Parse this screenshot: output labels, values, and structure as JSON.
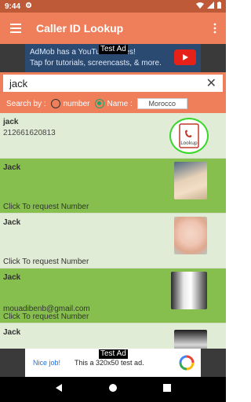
{
  "status": {
    "time": "9:44"
  },
  "appbar": {
    "title": "Caller ID Lookup"
  },
  "top_ad": {
    "tag": "Test Ad",
    "line1": "AdMob has a YouTube Series!",
    "line2": "Tap for tutorials, screencasts, & more."
  },
  "search": {
    "query": "jack"
  },
  "filter": {
    "label": "Search by :",
    "number_label": "number",
    "name_label": "Name :",
    "country": "Morocco"
  },
  "results": [
    {
      "name": "jack",
      "detail": "212661620813",
      "email": "",
      "action": ""
    },
    {
      "name": "Jack",
      "detail": "",
      "email": "",
      "action": "Click To request Number"
    },
    {
      "name": "Jack",
      "detail": "",
      "email": "",
      "action": "Click To request Number"
    },
    {
      "name": "Jack",
      "detail": "",
      "email": "mouadibenb@gmail.com",
      "action": "Click To request Number"
    },
    {
      "name": "Jack",
      "detail": "",
      "email": "",
      "action": ""
    }
  ],
  "bottom_ad": {
    "tag": "Test Ad",
    "nice": "Nice job!",
    "text": "This a 320x50 test ad."
  },
  "colors": {
    "primary": "#ef7f5a",
    "status": "#bf5a38",
    "row_dark": "#86bf4e",
    "row_light": "#e0ecd6"
  }
}
